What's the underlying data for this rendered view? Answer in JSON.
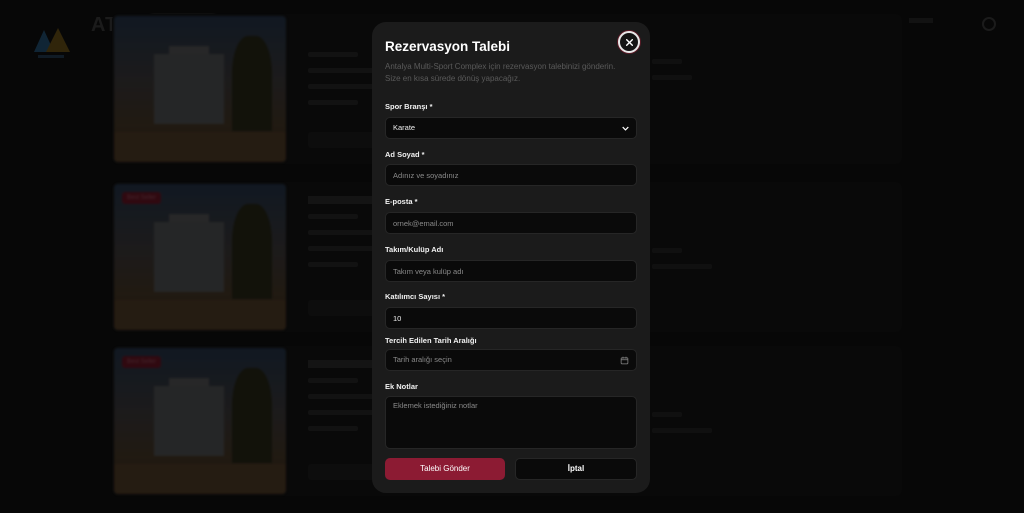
{
  "background": {
    "logo_text": "AT",
    "badge_text": "Best Seller"
  },
  "modal": {
    "title": "Rezervasyon Talebi",
    "subtitle": "Antalya Multi-Sport Complex için rezervasyon talebinizi gönderin. Size en kısa sürede dönüş yapacağız.",
    "close_icon": "close-icon",
    "fields": {
      "sport": {
        "label": "Spor Branşı *",
        "value": "Karate"
      },
      "name": {
        "label": "Ad Soyad *",
        "placeholder": "Adınız ve soyadınız"
      },
      "email": {
        "label": "E-posta *",
        "placeholder": "ornek@email.com"
      },
      "team": {
        "label": "Takım/Kulüp Adı",
        "placeholder": "Takım veya kulüp adı"
      },
      "participants": {
        "label": "Katılımcı Sayısı *",
        "value": "10"
      },
      "date_range": {
        "label": "Tercih Edilen Tarih Aralığı",
        "placeholder": "Tarih aralığı seçin"
      },
      "notes": {
        "label": "Ek Notlar",
        "placeholder": "Eklemek istediğiniz notlar"
      }
    },
    "submit_label": "Talebi Gönder",
    "cancel_label": "İptal"
  },
  "colors": {
    "accent": "#8c1b33",
    "modal_bg": "#1b1b1b",
    "input_bg": "#0a0a0a"
  }
}
